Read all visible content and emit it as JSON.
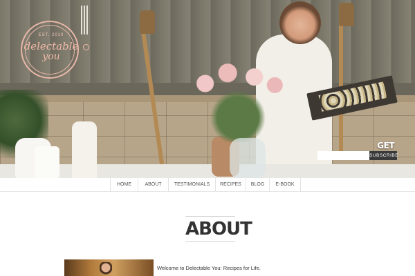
{
  "site": {
    "logo": {
      "established": "EST. 2010",
      "line1": "delectable",
      "line2": "you"
    }
  },
  "subscribe": {
    "heading": "GET DELECTABLE.",
    "email_placeholder": "",
    "button_label": "SUBSCRIBE"
  },
  "nav": {
    "items": [
      {
        "label": "HOME"
      },
      {
        "label": "ABOUT"
      },
      {
        "label": "TESTIMONIALS"
      },
      {
        "label": "RECIPES"
      },
      {
        "label": "BLOG"
      },
      {
        "label": "E-BOOK"
      }
    ]
  },
  "page": {
    "title": "ABOUT",
    "intro": "Welcome to Delectable You: Recipes for Life."
  },
  "colors": {
    "logo_accent": "#f0b9a6",
    "subscribe_button": "#3a3a3a",
    "title_text": "#333333"
  }
}
